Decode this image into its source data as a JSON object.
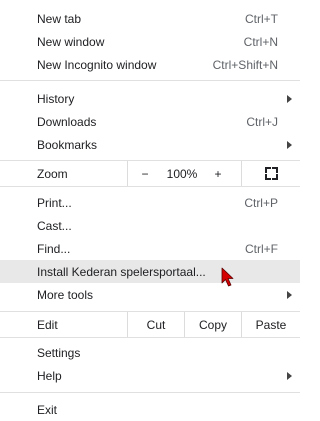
{
  "menu": {
    "new_tab": {
      "label": "New tab",
      "shortcut": "Ctrl+T"
    },
    "new_window": {
      "label": "New window",
      "shortcut": "Ctrl+N"
    },
    "new_incognito": {
      "label": "New Incognito window",
      "shortcut": "Ctrl+Shift+N"
    },
    "history": {
      "label": "History"
    },
    "downloads": {
      "label": "Downloads",
      "shortcut": "Ctrl+J"
    },
    "bookmarks": {
      "label": "Bookmarks"
    },
    "zoom": {
      "label": "Zoom",
      "minus": "−",
      "value": "100%",
      "plus": "+"
    },
    "print": {
      "label": "Print...",
      "shortcut": "Ctrl+P"
    },
    "cast": {
      "label": "Cast..."
    },
    "find": {
      "label": "Find...",
      "shortcut": "Ctrl+F"
    },
    "install": {
      "label": "Install Kederan spelersportaal..."
    },
    "more_tools": {
      "label": "More tools"
    },
    "edit": {
      "label": "Edit",
      "cut": "Cut",
      "copy": "Copy",
      "paste": "Paste"
    },
    "settings": {
      "label": "Settings"
    },
    "help": {
      "label": "Help"
    },
    "exit": {
      "label": "Exit"
    }
  },
  "icons": {
    "submenu": "chevron-right-icon",
    "fullscreen": "fullscreen-icon",
    "cursor": "mouse-pointer-icon"
  },
  "colors": {
    "hover": "#e8e8e8",
    "separator": "#e0e0e0",
    "cursor": "#d40000"
  }
}
